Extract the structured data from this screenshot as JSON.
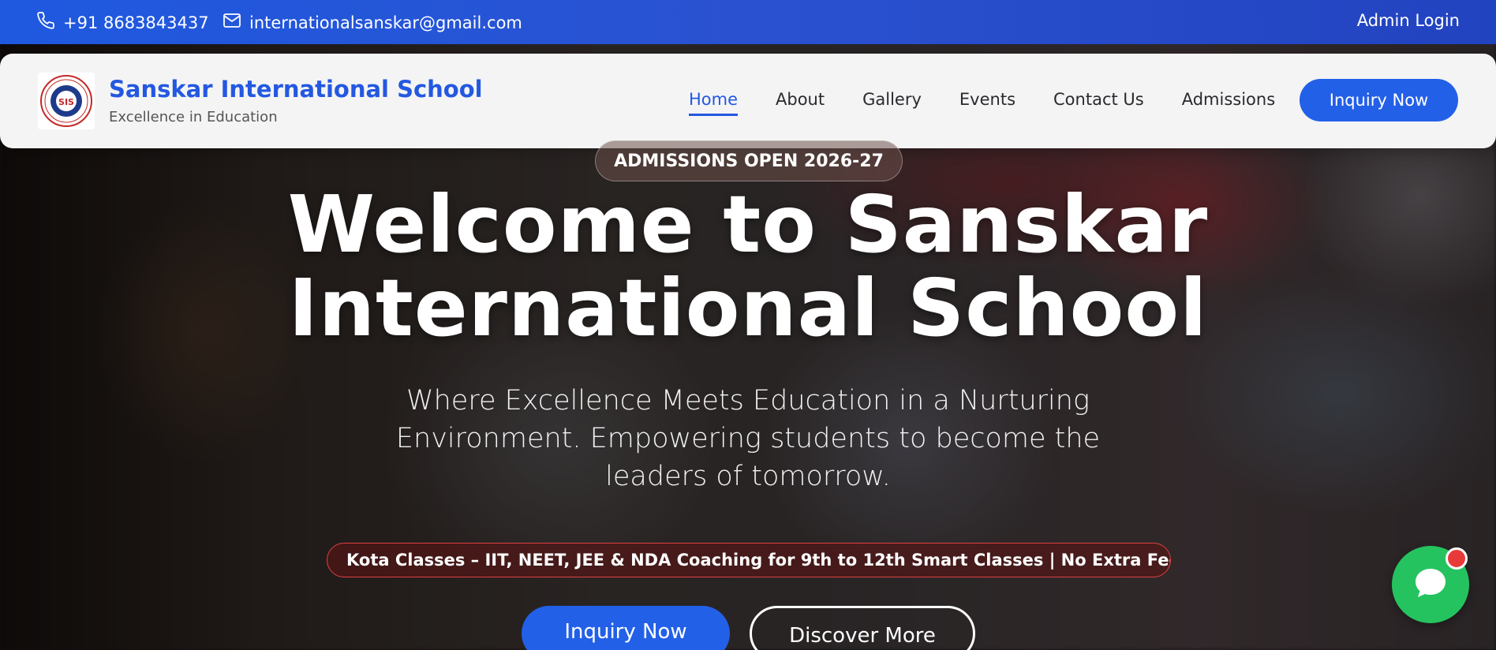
{
  "topbar": {
    "phone": "+91 8683843437",
    "email": "internationalsanskar@gmail.com",
    "admin_login": "Admin Login"
  },
  "navbar": {
    "brand_name": "Sanskar International School",
    "brand_tagline": "Excellence in Education",
    "links": [
      "Home",
      "About",
      "Gallery",
      "Events",
      "Contact Us",
      "Admissions"
    ],
    "active_link": "Home",
    "inquiry_label": "Inquiry Now"
  },
  "hero": {
    "badge": "ADMISSIONS OPEN 2026-27",
    "title_line1": "Welcome to Sanskar",
    "title_line2": "International School",
    "subtitle": "Where Excellence Meets Education in a Nurturing Environment. Empowering students to become the leaders of tomorrow.",
    "ticker": "Kota Classes – IIT, NEET, JEE & NDA Coaching for 9th to 12th Smart Classes | No Extra Fees |",
    "primary_button": "Inquiry Now",
    "secondary_button": "Discover More"
  },
  "colors": {
    "primary": "#2360e8",
    "chat": "#25c35f",
    "notification": "#e83a3a"
  },
  "icons": {
    "phone": "phone-icon",
    "email": "mail-icon",
    "chat": "chat-icon",
    "logo": "school-logo"
  }
}
